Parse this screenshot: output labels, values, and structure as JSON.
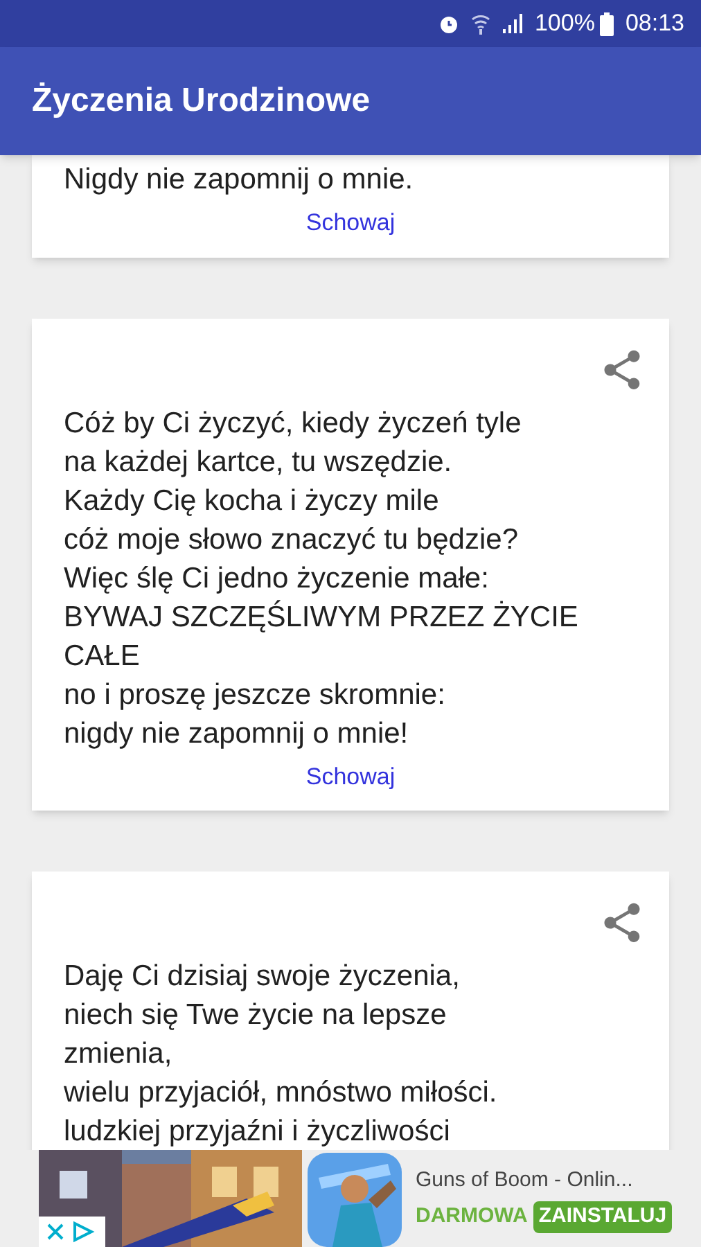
{
  "status_bar": {
    "battery": "100%",
    "time": "08:13"
  },
  "app_bar": {
    "title": "Życzenia Urodzinowe"
  },
  "cards": [
    {
      "share": false,
      "lines": [
        "Nigdy nie zapomnij o mnie."
      ],
      "hide_link": "Schowaj"
    },
    {
      "share": true,
      "lines": [
        "Cóż by Ci życzyć, kiedy życzeń tyle",
        "na każdej kartce, tu wszędzie.",
        "Każdy Cię kocha i życzy mile",
        "cóż moje słowo znaczyć tu będzie?",
        "Więc ślę Ci jedno życzenie małe:",
        "BYWAJ SZCZĘŚLIWYM PRZEZ ŻYCIE",
        "CAŁE",
        "no i proszę jeszcze skromnie:",
        "nigdy nie zapomnij o mnie!"
      ],
      "hide_link": "Schowaj"
    },
    {
      "share": true,
      "lines": [
        "Daję Ci dzisiaj swoje życzenia,",
        "niech się Twe życie na lepsze",
        "zmienia,",
        "wielu przyjaciół, mnóstwo miłości.",
        "ludzkiej przyjaźni i życzliwości"
      ]
    }
  ],
  "ad": {
    "title": "Guns of Boom - Onlin...",
    "label": "DARMOWA",
    "button": "ZAINSTALUJ"
  }
}
